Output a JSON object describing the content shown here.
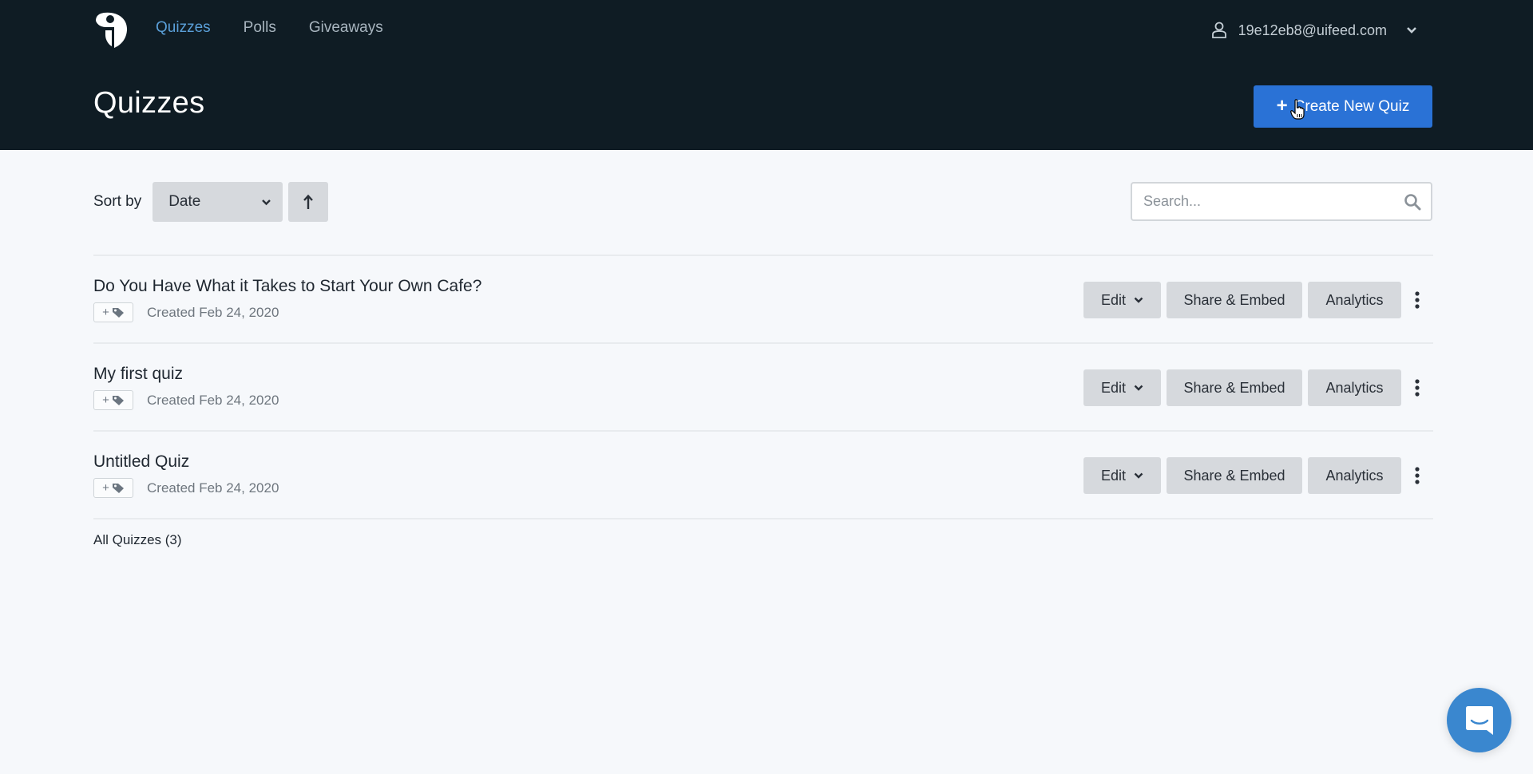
{
  "header": {
    "logo": "uifeed-logo",
    "nav": [
      {
        "label": "Quizzes",
        "active": true
      },
      {
        "label": "Polls",
        "active": false
      },
      {
        "label": "Giveaways",
        "active": false
      }
    ],
    "user": {
      "email": "19e12eb8@uifeed.com",
      "icon": "user-icon",
      "menu_icon": "chevron-down-icon"
    },
    "page_title": "Quizzes",
    "create_button": {
      "icon": "plus",
      "label": "Create New Quiz"
    }
  },
  "toolbar": {
    "sort_label": "Sort by",
    "sort_value": "Date",
    "sort_direction": "ascending",
    "search": {
      "placeholder": "Search...",
      "value": ""
    }
  },
  "quizzes": [
    {
      "title": "Do You Have What it Takes to Start Your Own Cafe?",
      "tag_button": "+",
      "created": "Created Feb 24, 2020"
    },
    {
      "title": "My first quiz",
      "tag_button": "+",
      "created": "Created Feb 24, 2020"
    },
    {
      "title": "Untitled Quiz",
      "tag_button": "+",
      "created": "Created Feb 24, 2020"
    }
  ],
  "row_actions": {
    "edit": "Edit",
    "share": "Share & Embed",
    "analytics": "Analytics"
  },
  "footer": {
    "count_label": "All Quizzes (3)"
  },
  "colors": {
    "header_bg": "#0f1c24",
    "accent": "#2a72d6",
    "nav_active": "#5a9fd8",
    "chat": "#3a87cf"
  }
}
